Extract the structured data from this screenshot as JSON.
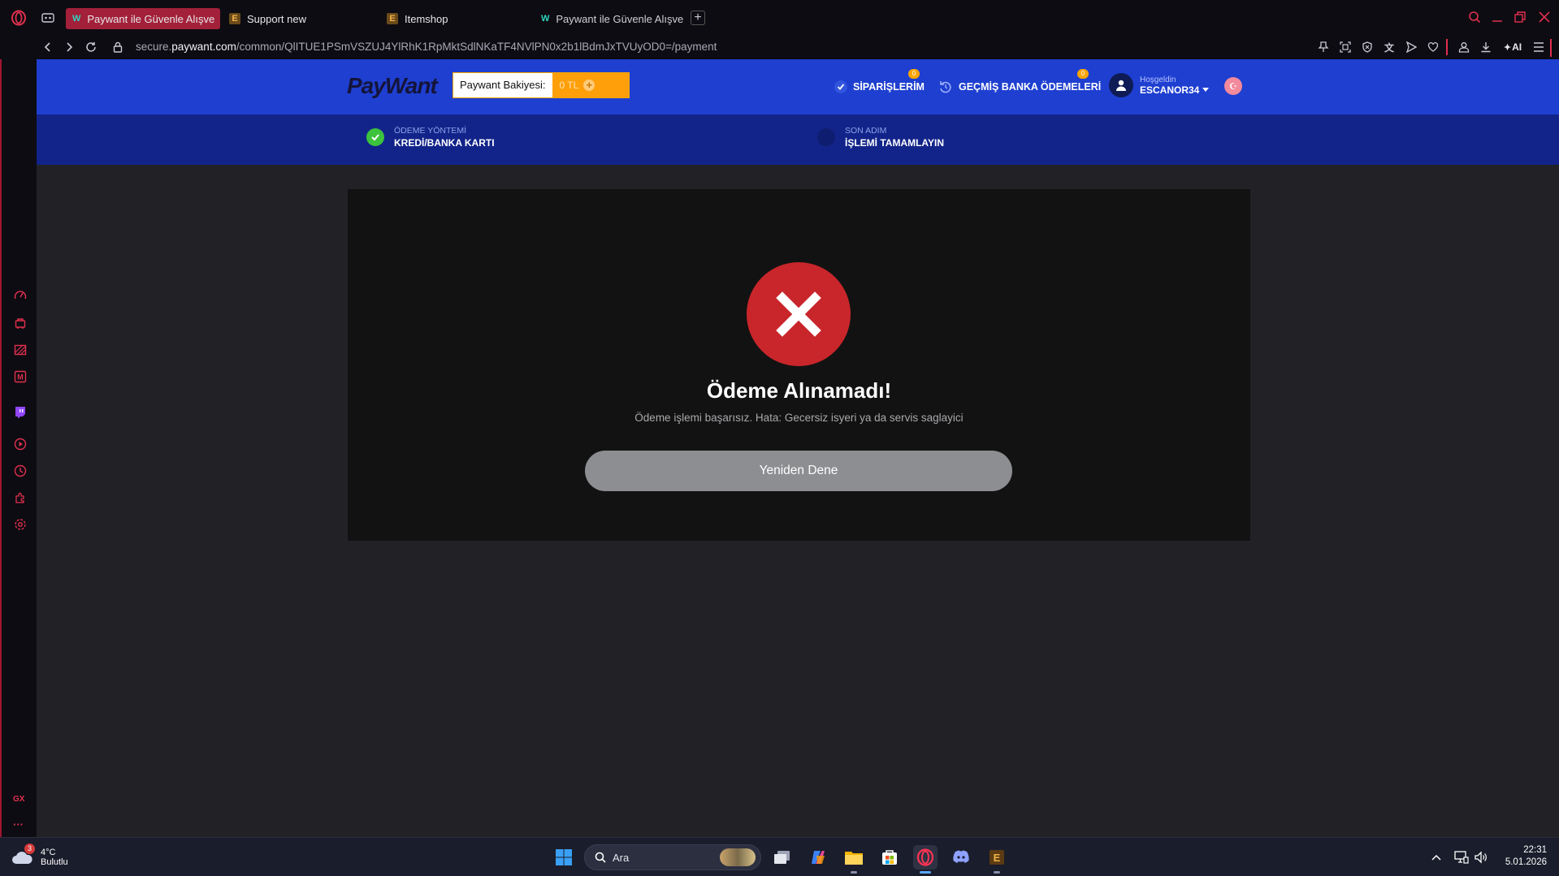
{
  "browser": {
    "tabs": [
      {
        "label": "Paywant ile Güvenle Alışve",
        "active": true
      },
      {
        "label": "Support new",
        "active": false
      },
      {
        "label": "Itemshop",
        "active": false
      },
      {
        "label": "Paywant ile Güvenle Alışve",
        "active": false
      }
    ],
    "new_tab_label": "+",
    "url_prefix": "secure.",
    "url_domain": "paywant.com",
    "url_path": "/common/QlITUE1PSmVSZUJ4YlRhK1RpMktSdlNKaTF4NVlPN0x2b1lBdmJxTVUyOD0=/payment",
    "ai_label": "AI",
    "accent_color": "#a3203a"
  },
  "sidebar": {
    "icons": [
      "speed-dial-icon",
      "cart-icon",
      "gx-corner-icon",
      "messenger-icon",
      "twitch-icon",
      "player-icon",
      "history-icon",
      "extensions-icon",
      "settings-icon"
    ],
    "gx_label": "GX",
    "more_label": "···"
  },
  "paywant": {
    "logo": "PayWant",
    "balance_label": "Paywant Bakiyesi:",
    "balance_value": "0 TL",
    "orders_label": "SİPARİŞLERİM",
    "orders_badge": "0",
    "bank_history_label": "GEÇMİŞ BANKA ÖDEMELERİ",
    "bank_history_badge": "0",
    "welcome_label": "Hoşgeldin",
    "username": "ESCANOR34",
    "header_color": "#1e3fd0",
    "steps_color": "#12248a"
  },
  "steps": {
    "step1_caption": "ÖDEME YÖNTEMİ",
    "step1_value": "KREDİ/BANKA KARTI",
    "step2_caption": "SON ADIM",
    "step2_value": "İŞLEMİ TAMAMLAYIN"
  },
  "result": {
    "title": "Ödeme Alınamadı!",
    "message": "Ödeme işlemi başarısız. Hata: Gecersiz isyeri ya da servis saglayici",
    "retry_label": "Yeniden Dene",
    "error_color": "#c8262b"
  },
  "taskbar": {
    "weather_temp": "4°C",
    "weather_desc": "Bulutlu",
    "weather_badge": "3",
    "search_placeholder": "Ara",
    "time": "22:31",
    "date": "5.01.2026"
  }
}
